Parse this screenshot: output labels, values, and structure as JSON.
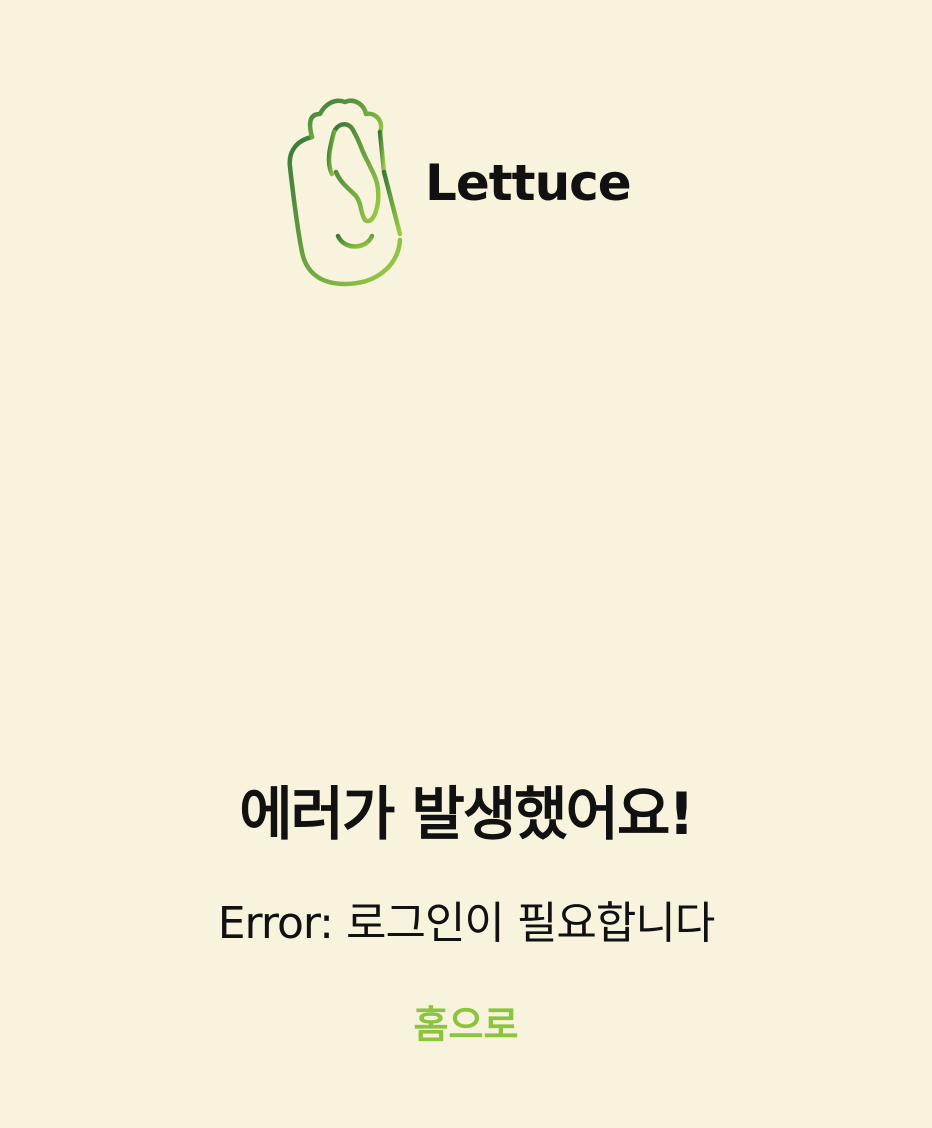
{
  "logo": {
    "text": "Lettuce",
    "icon": "lettuce-mascot-icon"
  },
  "error": {
    "title": "에러가 발생했어요!",
    "message": "Error: 로그인이 필요합니다"
  },
  "nav": {
    "home_label": "홈으로"
  },
  "colors": {
    "background": "#f7f3dc",
    "text": "#111111",
    "accent": "#8cc43f",
    "logo_gradient_start": "#3a7a3a",
    "logo_gradient_end": "#9ccc45"
  }
}
